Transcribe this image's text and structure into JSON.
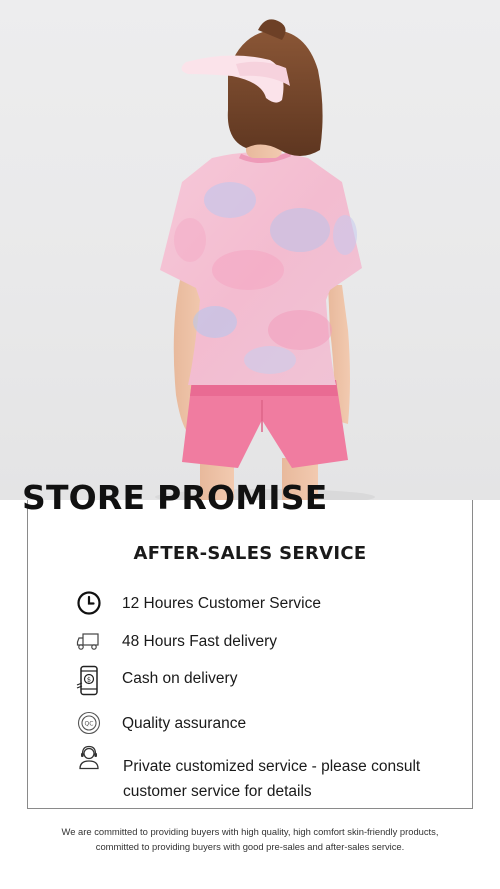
{
  "hero": {
    "icon": "product-photo-girl-pink-tie-dye-tee-and-shorts"
  },
  "store_promise": {
    "title": "STORE PROMISE"
  },
  "after_sales": {
    "title": "AFTER-SALES SERVICE",
    "items": [
      {
        "icon": "clock-icon",
        "label": "12 Houres Customer Service"
      },
      {
        "icon": "delivery-truck-icon",
        "label": "48 Hours Fast delivery"
      },
      {
        "icon": "phone-cash-icon",
        "label": "Cash on delivery"
      },
      {
        "icon": "quality-badge-icon",
        "label": "Quality assurance"
      },
      {
        "icon": "customer-service-agent-icon",
        "label": "Private customized service - please consult customer service for details"
      }
    ]
  },
  "footer": {
    "line1": "We are committed to providing buyers with high quality, high comfort skin-friendly products,",
    "line2": "committed to providing buyers with good pre-sales and after-sales service."
  }
}
